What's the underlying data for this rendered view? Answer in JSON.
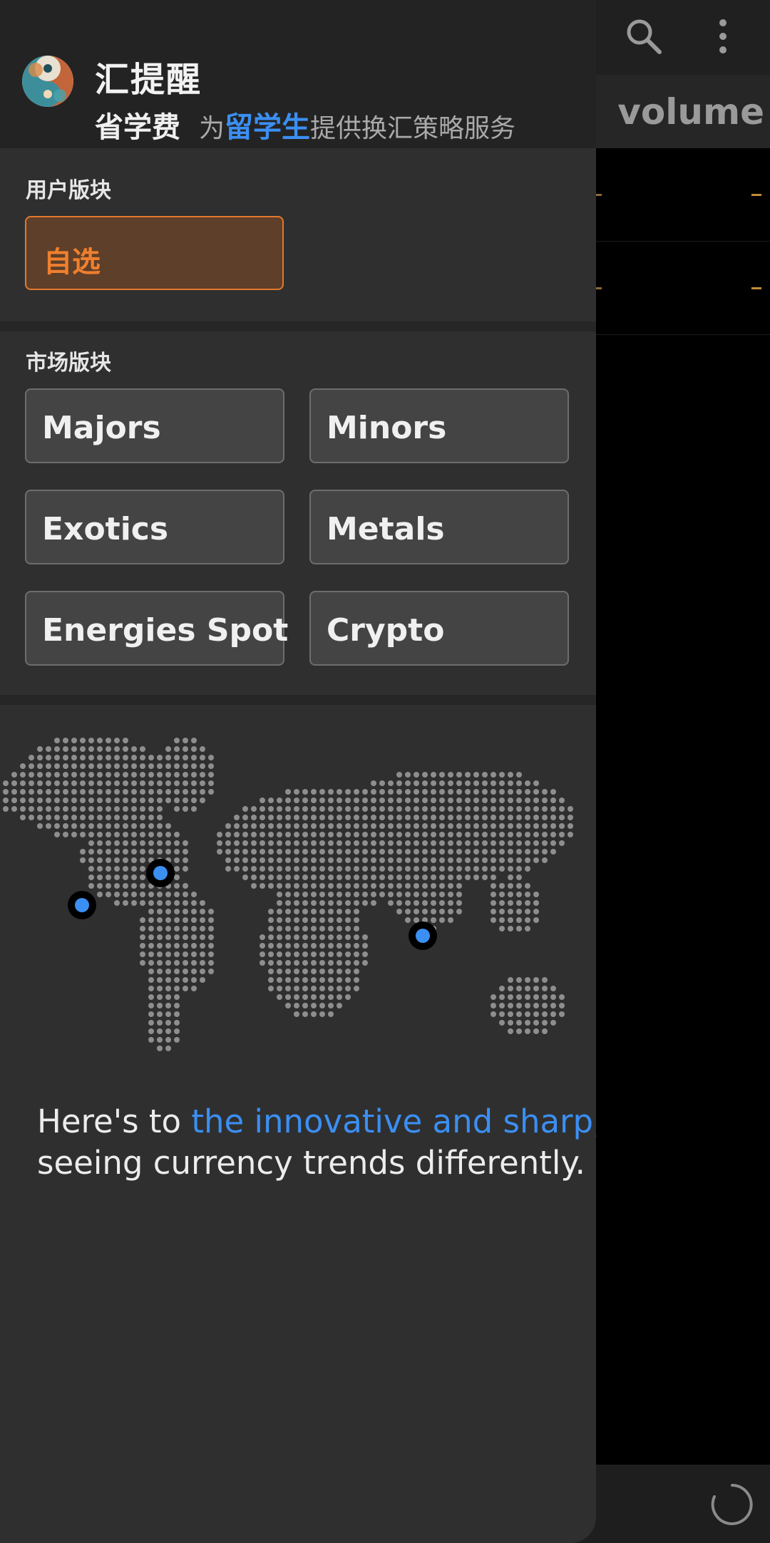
{
  "background": {
    "visible_tab_label": "volume",
    "icons": [
      "search-icon",
      "more-vert-icon",
      "loading-spinner-icon"
    ]
  },
  "drawer": {
    "app_name": "汇提醒",
    "tagline": {
      "strong": "省学费",
      "prefix": "为",
      "accent": "留学生",
      "suffix": "提供换汇策略服务"
    },
    "user_section": {
      "title": "用户版块",
      "favorites_label": "自选"
    },
    "market_section": {
      "title": "市场版块",
      "buttons": [
        "Majors",
        "Minors",
        "Exotics",
        "Metals",
        "Energies Spot",
        "Crypto"
      ]
    },
    "slogan": {
      "line1_prefix": "Here's to ",
      "line1_accent": "the innovative and sharp",
      "line1_suffix": ",",
      "line2": "seeing currency trends differently."
    }
  },
  "colors": {
    "accent_blue": "#3b8ff2",
    "accent_orange": "#f07f2e",
    "drawer_bg": "#2f2f2f"
  }
}
